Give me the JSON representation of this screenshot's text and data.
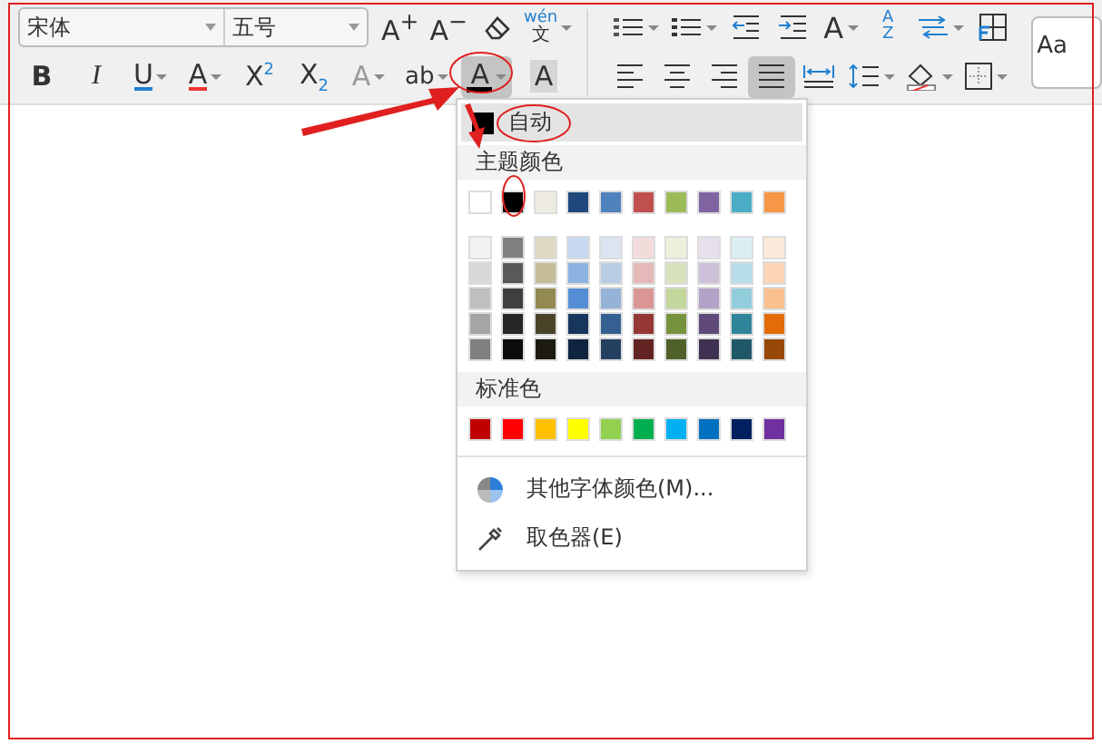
{
  "ribbon": {
    "font_name": "宋体",
    "font_size": "五号",
    "row1_left": [
      {
        "kind": "text",
        "label": "A$^{+}$"
      },
      {
        "kind": "text",
        "label": "A$^{−}$"
      },
      {
        "kind": "eraser"
      },
      {
        "kind": "pinyin",
        "label": "wén",
        "sub": "文",
        "caret": true
      }
    ],
    "row1_right": [
      {
        "kind": "bullets",
        "caret": true
      },
      {
        "kind": "numbering",
        "caret": true
      },
      {
        "kind": "outdent",
        "caret": false
      },
      {
        "kind": "indent",
        "caret": false
      },
      {
        "kind": "spacing",
        "label": "A",
        "caret": true
      },
      {
        "kind": "sort",
        "label": "AZ",
        "caret": false
      },
      {
        "kind": "swap",
        "caret": true
      },
      {
        "kind": "table",
        "caret": false
      }
    ],
    "row2_left": [
      {
        "kind": "bold",
        "label": "B",
        "caret": false,
        "selected": false,
        "disabled": false
      },
      {
        "kind": "italic",
        "label": "I",
        "caret": false,
        "selected": false,
        "disabled": false
      },
      {
        "kind": "underline",
        "label": "U",
        "caret": true,
        "selected": false,
        "disabled": false
      },
      {
        "kind": "strike",
        "label": "A",
        "caret": true,
        "selected": false,
        "disabled": false
      },
      {
        "kind": "sup",
        "label": "X$^{2}$",
        "caret": false,
        "selected": false,
        "disabled": false
      },
      {
        "kind": "sub",
        "label": "X$_{2}$",
        "caret": false,
        "selected": false,
        "disabled": false
      },
      {
        "kind": "outline",
        "label": "A",
        "caret": true,
        "selected": false,
        "disabled": true
      },
      {
        "kind": "highlight",
        "label": "ab",
        "caret": true,
        "selected": false,
        "disabled": false
      },
      {
        "kind": "fontcolor",
        "label": "A",
        "caret": true,
        "selected": true,
        "disabled": false
      },
      {
        "kind": "shade",
        "label": "A",
        "caret": false,
        "selected": false,
        "disabled": false
      }
    ],
    "row2_right": [
      {
        "kind": "align-left",
        "caret": false,
        "selected": false
      },
      {
        "kind": "align-center",
        "caret": false,
        "selected": false
      },
      {
        "kind": "align-right",
        "caret": false,
        "selected": false
      },
      {
        "kind": "justify",
        "caret": false,
        "selected": true
      },
      {
        "kind": "distribute",
        "caret": false,
        "selected": false
      },
      {
        "kind": "line-spacing",
        "caret": true,
        "selected": false
      },
      {
        "kind": "fill",
        "caret": true,
        "selected": false
      },
      {
        "kind": "border",
        "caret": true,
        "selected": false
      }
    ],
    "styles_preview": "Aa"
  },
  "color_menu": {
    "automatic": {
      "label": "自动",
      "color": "#000000"
    },
    "theme_header": "主题颜色",
    "theme_colors": [
      {
        "color": "#ffffff"
      },
      {
        "color": "#000000"
      },
      {
        "color": "#eeece1"
      },
      {
        "color": "#1f497d"
      },
      {
        "color": "#4f81bd"
      },
      {
        "color": "#c0504d"
      },
      {
        "color": "#9bbb59"
      },
      {
        "color": "#8064a2"
      },
      {
        "color": "#4bacc6"
      },
      {
        "color": "#f79646"
      }
    ],
    "tints": [
      [
        {
          "color": "#f2f2f2"
        },
        {
          "color": "#7f7f7f"
        },
        {
          "color": "#ddd9c3"
        },
        {
          "color": "#c6d9f0"
        },
        {
          "color": "#dbe5f1"
        },
        {
          "color": "#f2dcdb"
        },
        {
          "color": "#ebf1dd"
        },
        {
          "color": "#e5e0ec"
        },
        {
          "color": "#dbeef3"
        },
        {
          "color": "#fdeada"
        }
      ],
      [
        {
          "color": "#d8d8d8"
        },
        {
          "color": "#595959"
        },
        {
          "color": "#c4bd97"
        },
        {
          "color": "#8db3e2"
        },
        {
          "color": "#b8cce4"
        },
        {
          "color": "#e5b9b7"
        },
        {
          "color": "#d7e3bc"
        },
        {
          "color": "#ccc1d9"
        },
        {
          "color": "#b7dde8"
        },
        {
          "color": "#fbd5b5"
        }
      ],
      [
        {
          "color": "#bfbfbf"
        },
        {
          "color": "#3f3f3f"
        },
        {
          "color": "#938953"
        },
        {
          "color": "#548dd4"
        },
        {
          "color": "#95b3d7"
        },
        {
          "color": "#d99694"
        },
        {
          "color": "#c3d69b"
        },
        {
          "color": "#b2a2c7"
        },
        {
          "color": "#92cddc"
        },
        {
          "color": "#fac08f"
        }
      ],
      [
        {
          "color": "#a5a5a5"
        },
        {
          "color": "#262626"
        },
        {
          "color": "#494429"
        },
        {
          "color": "#17365d"
        },
        {
          "color": "#366092"
        },
        {
          "color": "#953734"
        },
        {
          "color": "#76923c"
        },
        {
          "color": "#5f497a"
        },
        {
          "color": "#31859b"
        },
        {
          "color": "#e36c09"
        }
      ],
      [
        {
          "color": "#7f7f7f"
        },
        {
          "color": "#0c0c0c"
        },
        {
          "color": "#1d1b10"
        },
        {
          "color": "#0f243e"
        },
        {
          "color": "#244061"
        },
        {
          "color": "#632423"
        },
        {
          "color": "#4f6128"
        },
        {
          "color": "#3f3151"
        },
        {
          "color": "#205867"
        },
        {
          "color": "#974806"
        }
      ]
    ],
    "standard_header": "标准色",
    "standard_colors": [
      {
        "color": "#c00000"
      },
      {
        "color": "#ff0000"
      },
      {
        "color": "#ffc000"
      },
      {
        "color": "#ffff00"
      },
      {
        "color": "#92d050"
      },
      {
        "color": "#00b050"
      },
      {
        "color": "#00b0f0"
      },
      {
        "color": "#0070c0"
      },
      {
        "color": "#002060"
      },
      {
        "color": "#7030a0"
      }
    ],
    "actions": [
      {
        "kind": "more",
        "label": "其他字体颜色(M)..."
      },
      {
        "kind": "picker",
        "label": "取色器(E)"
      }
    ]
  }
}
